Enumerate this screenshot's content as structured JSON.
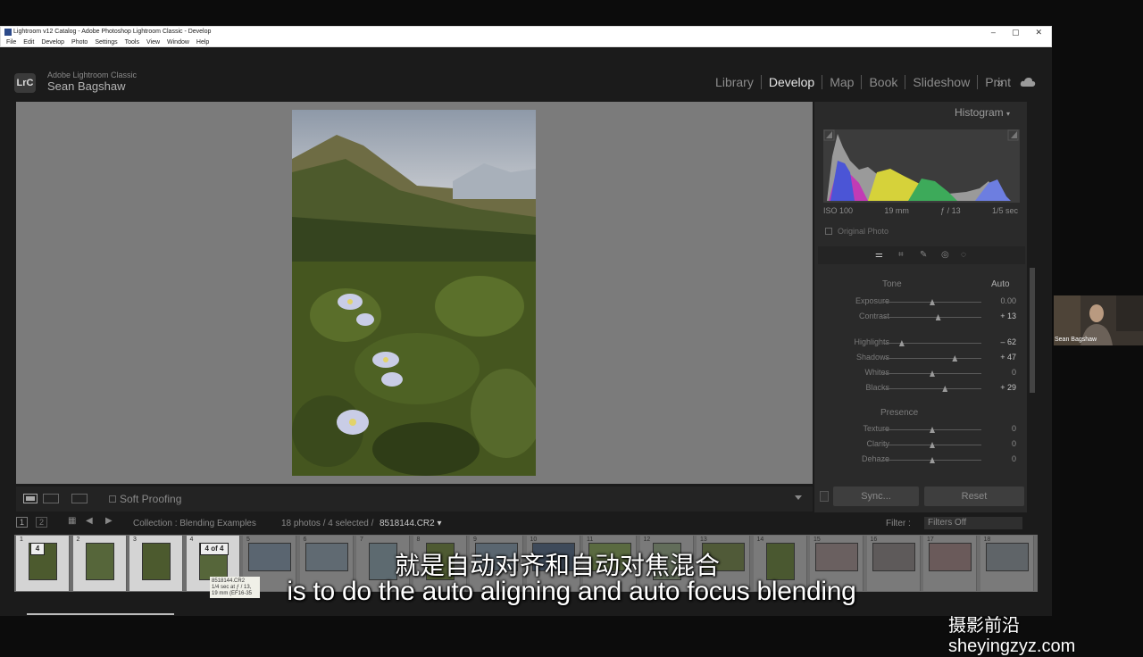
{
  "window": {
    "title": "Lightroom v12 Catalog - Adobe Photoshop Lightroom Classic - Develop",
    "menu": [
      "File",
      "Edit",
      "Develop",
      "Photo",
      "Settings",
      "Tools",
      "View",
      "Window",
      "Help"
    ],
    "controls": [
      "–",
      "▢",
      "✕"
    ]
  },
  "identity": {
    "logo": "LrC",
    "app_name": "Adobe Lightroom Classic",
    "user": "Sean Bagshaw"
  },
  "modules": [
    "Library",
    "Develop",
    "Map",
    "Book",
    "Slideshow",
    "Print"
  ],
  "active_module": "Develop",
  "more_modules": "»",
  "toolbar": {
    "soft_proofing": "Soft Proofing"
  },
  "histogram": {
    "title": "Histogram",
    "iso": "ISO 100",
    "focal": "19 mm",
    "aperture": "ƒ / 13",
    "shutter": "1/5 sec",
    "original_photo": "Original Photo"
  },
  "tone": {
    "header": "Tone",
    "auto": "Auto",
    "sliders": [
      {
        "label": "Exposure",
        "value": "0.00",
        "pos": 0.5
      },
      {
        "label": "Contrast",
        "value": "+ 13",
        "pos": 0.56
      },
      {
        "label": "Highlights",
        "value": "– 62",
        "pos": 0.19
      },
      {
        "label": "Shadows",
        "value": "+ 47",
        "pos": 0.73
      },
      {
        "label": "Whites",
        "value": "0",
        "pos": 0.5
      },
      {
        "label": "Blacks",
        "value": "+ 29",
        "pos": 0.63
      }
    ]
  },
  "presence": {
    "header": "Presence",
    "sliders": [
      {
        "label": "Texture",
        "value": "0",
        "pos": 0.5
      },
      {
        "label": "Clarity",
        "value": "0",
        "pos": 0.5
      },
      {
        "label": "Dehaze",
        "value": "0",
        "pos": 0.5
      }
    ]
  },
  "buttons": {
    "sync": "Sync...",
    "reset": "Reset"
  },
  "filmstrip_bar": {
    "view_numbers": [
      "1",
      "2"
    ],
    "collection": "Collection : Blending Examples",
    "count": "18 photos / 4 selected /",
    "file": "8518144.CR2 ▾",
    "filter_label": "Filter :",
    "filter_value": "Filters Off"
  },
  "filmstrip": {
    "cells": [
      "1",
      "2",
      "3",
      "4",
      "5",
      "6",
      "7",
      "8",
      "9",
      "10",
      "11",
      "12",
      "13",
      "14",
      "15",
      "16",
      "17",
      "18"
    ],
    "stack_badge_1": "4",
    "stack_badge_4": "4 of 4",
    "tooltip": [
      "8518144.CR2",
      "1/4 sec at ƒ / 13,",
      "19 mm (EF16-35"
    ]
  },
  "webcam": {
    "name": "Sean Bagshaw"
  },
  "subtitles": {
    "chinese": "就是自动对齐和自动对焦混合",
    "english": "is to do the auto aligning and auto focus blending"
  },
  "watermark": "摄影前沿 sheyingzyz.com"
}
